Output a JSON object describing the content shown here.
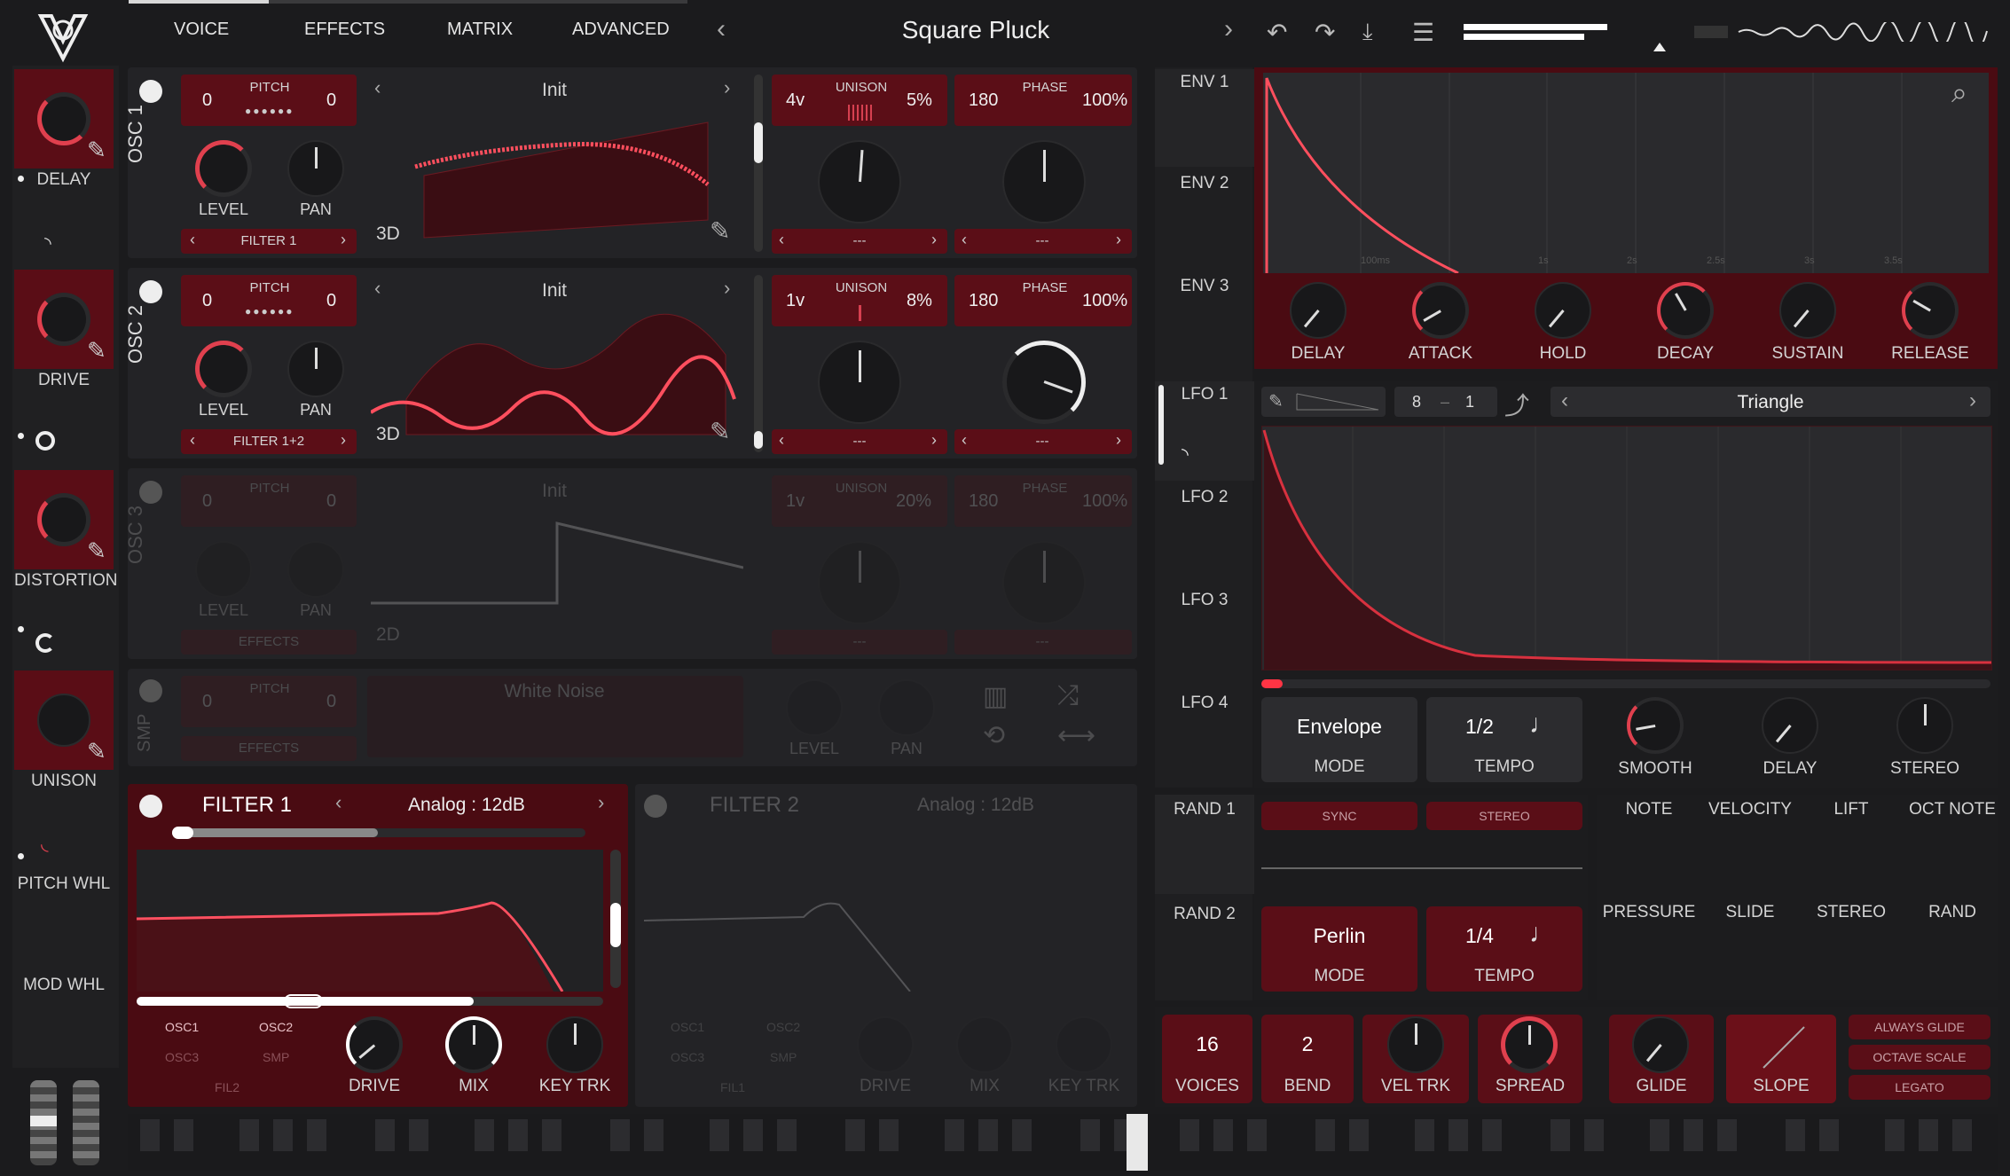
{
  "header": {
    "tabs": [
      "VOICE",
      "EFFECTS",
      "MATRIX",
      "ADVANCED"
    ],
    "preset": "Square Pluck"
  },
  "sidebar": {
    "items": [
      "DELAY",
      "DRIVE",
      "DISTORTION",
      "UNISON",
      "PITCH WHL",
      "MOD WHL"
    ]
  },
  "osc": [
    {
      "name": "OSC 1",
      "pitch_left": "0",
      "pitch_label": "PITCH",
      "pitch_right": "0",
      "level": "LEVEL",
      "pan": "PAN",
      "dest": "FILTER 1",
      "wave": "Init",
      "view": "3D",
      "unison_voices": "4v",
      "unison_label": "UNISON",
      "unison_pct": "5%",
      "phase_val": "180",
      "phase_label": "PHASE",
      "phase_pct": "100%",
      "sel_a": "---",
      "sel_b": "---"
    },
    {
      "name": "OSC 2",
      "pitch_left": "0",
      "pitch_label": "PITCH",
      "pitch_right": "0",
      "level": "LEVEL",
      "pan": "PAN",
      "dest": "FILTER 1+2",
      "wave": "Init",
      "view": "3D",
      "unison_voices": "1v",
      "unison_label": "UNISON",
      "unison_pct": "8%",
      "phase_val": "180",
      "phase_label": "PHASE",
      "phase_pct": "100%",
      "sel_a": "---",
      "sel_b": "---"
    },
    {
      "name": "OSC 3",
      "pitch_left": "0",
      "pitch_label": "PITCH",
      "pitch_right": "0",
      "level": "LEVEL",
      "pan": "PAN",
      "dest": "EFFECTS",
      "wave": "Init",
      "view": "2D",
      "unison_voices": "1v",
      "unison_label": "UNISON",
      "unison_pct": "20%",
      "phase_val": "180",
      "phase_label": "PHASE",
      "phase_pct": "100%",
      "sel_a": "---",
      "sel_b": "---"
    }
  ],
  "smp": {
    "name": "SMP",
    "pitch_left": "0",
    "pitch_label": "PITCH",
    "pitch_right": "0",
    "dest": "EFFECTS",
    "sample": "White Noise",
    "level": "LEVEL",
    "pan": "PAN"
  },
  "filter1": {
    "name": "FILTER 1",
    "model": "Analog : 12dB",
    "src": [
      "OSC1",
      "OSC2",
      "OSC3",
      "SMP",
      "FIL2"
    ],
    "knobs": [
      "DRIVE",
      "MIX",
      "KEY TRK"
    ]
  },
  "filter2": {
    "name": "FILTER 2",
    "model": "Analog : 12dB",
    "src": [
      "OSC1",
      "OSC2",
      "OSC3",
      "SMP",
      "FIL1"
    ],
    "knobs": [
      "DRIVE",
      "MIX",
      "KEY TRK"
    ]
  },
  "env": {
    "tabs": [
      "ENV 1",
      "ENV 2",
      "ENV 3"
    ],
    "knobs": [
      "DELAY",
      "ATTACK",
      "HOLD",
      "DECAY",
      "SUSTAIN",
      "RELEASE"
    ],
    "times": [
      "100ms",
      "1s",
      "2s",
      "2.5s",
      "3s",
      "3.5s"
    ]
  },
  "lfo": {
    "tabs": [
      "LFO 1",
      "LFO 2",
      "LFO 3",
      "LFO 4"
    ],
    "grid_num": "8",
    "grid_dash": "–",
    "grid_den": "1",
    "shape": "Triangle",
    "mode_val": "Envelope",
    "mode_label": "MODE",
    "tempo_val": "1/2",
    "tempo_label": "TEMPO",
    "knobs": [
      "SMOOTH",
      "DELAY",
      "STEREO"
    ]
  },
  "rand": {
    "tabs": [
      "RAND 1",
      "RAND 2"
    ],
    "sync": "SYNC",
    "stereo": "STEREO",
    "mode_val": "Perlin",
    "mode_label": "MODE",
    "tempo_val": "1/4",
    "tempo_label": "TEMPO"
  },
  "sources": [
    "NOTE",
    "VELOCITY",
    "LIFT",
    "OCT NOTE",
    "PRESSURE",
    "SLIDE",
    "STEREO",
    "RAND"
  ],
  "voice": {
    "voices_val": "16",
    "voices_label": "VOICES",
    "bend_val": "2",
    "bend_label": "BEND",
    "knobs": [
      "VEL TRK",
      "SPREAD",
      "GLIDE"
    ],
    "slope": "SLOPE",
    "options": [
      "ALWAYS GLIDE",
      "OCTAVE SCALE",
      "LEGATO"
    ]
  }
}
